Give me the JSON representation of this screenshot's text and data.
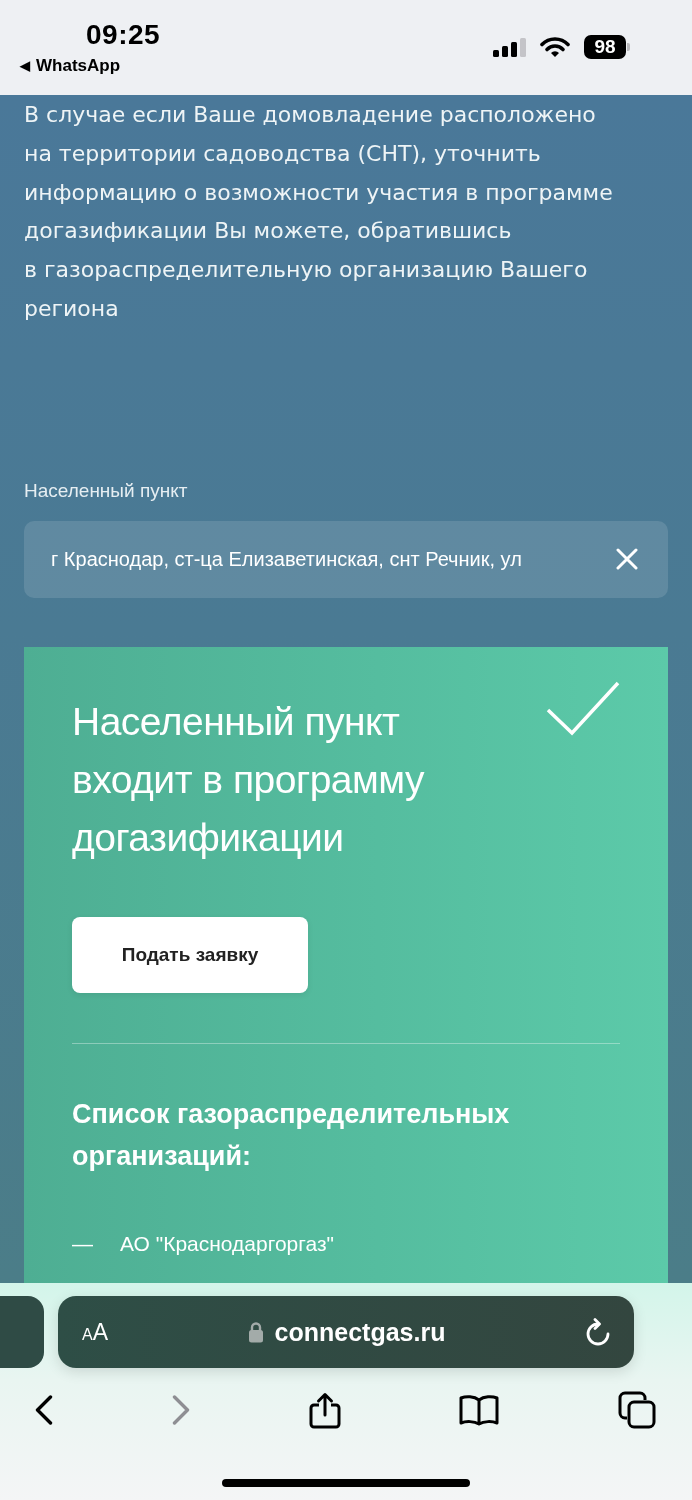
{
  "status_bar": {
    "time": "09:25",
    "back_glyph": "◀",
    "back_app": "WhatsApp",
    "battery": "98"
  },
  "intro": "В случае если Ваше домовладение расположено на территории садоводства (СНТ), уточнить информацию о возможности участия в программе догазификации Вы можете, обратившись в газораспределительную организацию Вашего региона",
  "locality_field": {
    "label": "Населенный пункт",
    "value": "г Краснодар, ст-ца Елизаветинская, снт Речник, ул"
  },
  "result_card": {
    "title": "Населенный пункт входит в программу догазификации",
    "button": "Подать заявку",
    "list_heading": "Список газораспределительных организаций:",
    "organizations": [
      {
        "marker": "—",
        "name": "АО \"Краснодаргоргаз\""
      }
    ]
  },
  "browser": {
    "text_size": "AA",
    "url": "connectgas.ru",
    "nav": [
      {
        "kind": "back",
        "disabled": false
      },
      {
        "kind": "forward",
        "disabled": true
      },
      {
        "kind": "share",
        "disabled": false
      },
      {
        "kind": "bookmarks",
        "disabled": false
      },
      {
        "kind": "tabs",
        "disabled": false
      }
    ]
  }
}
